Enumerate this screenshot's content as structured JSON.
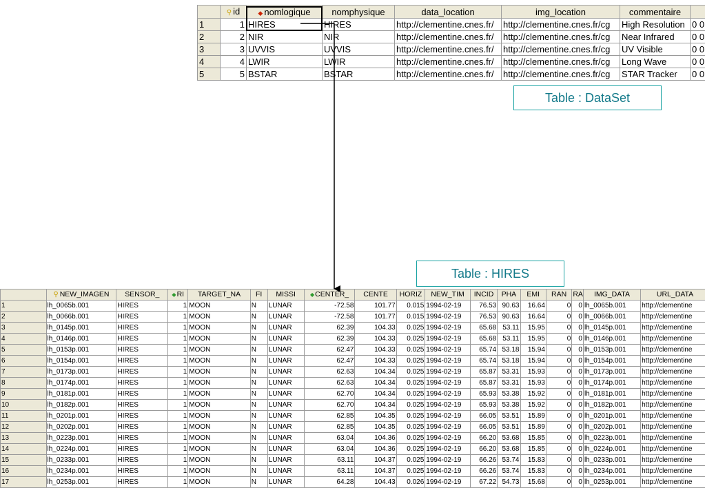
{
  "dataset_table": {
    "headers": [
      "id",
      "nomlogique",
      "nomphysique",
      "data_location",
      "img_location",
      "commentaire",
      ""
    ],
    "rows": [
      {
        "rownum": "1",
        "id": "1",
        "nomlogique": "HIRES",
        "nomphysique": "HIRES",
        "data_location": "http://clementine.cnes.fr/",
        "img_location": "http://clementine.cnes.fr/cg",
        "commentaire": "High Resolution",
        "extra": "0 0"
      },
      {
        "rownum": "2",
        "id": "2",
        "nomlogique": "NIR",
        "nomphysique": "NIR",
        "data_location": "http://clementine.cnes.fr/",
        "img_location": "http://clementine.cnes.fr/cg",
        "commentaire": "Near Infrared",
        "extra": "0 0"
      },
      {
        "rownum": "3",
        "id": "3",
        "nomlogique": "UVVIS",
        "nomphysique": "UVVIS",
        "data_location": "http://clementine.cnes.fr/",
        "img_location": "http://clementine.cnes.fr/cg",
        "commentaire": "UV Visible",
        "extra": "0 0"
      },
      {
        "rownum": "4",
        "id": "4",
        "nomlogique": "LWIR",
        "nomphysique": "LWIR",
        "data_location": "http://clementine.cnes.fr/",
        "img_location": "http://clementine.cnes.fr/cg",
        "commentaire": "Long Wave",
        "extra": "0 0"
      },
      {
        "rownum": "5",
        "id": "5",
        "nomlogique": "BSTAR",
        "nomphysique": "BSTAR",
        "data_location": "http://clementine.cnes.fr/",
        "img_location": "http://clementine.cnes.fr/cg",
        "commentaire": "STAR Tracker",
        "extra": "0 0"
      }
    ]
  },
  "callouts": {
    "dataset": "Table : DataSet",
    "hires": "Table : HIRES"
  },
  "hires_table": {
    "headers": [
      "NEW_IMAGEN",
      "SENSOR_",
      "RI",
      "TARGET_NA",
      "FI",
      "MISSI",
      "CENTER_",
      "CENTE",
      "HORIZ",
      "NEW_TIM",
      "INCID",
      "PHA",
      "EMI",
      "RAN",
      "RA",
      "IMG_DATA",
      "URL_DATA"
    ],
    "rows": [
      {
        "rownum": "1",
        "cells": [
          "lh_0065b.001",
          "HIRES",
          "1",
          "MOON",
          "N",
          "LUNAR",
          "-72.58",
          "101.77",
          "0.015",
          "1994-02-19",
          "76.53",
          "90.63",
          "16.64",
          "0",
          "0",
          "lh_0065b.001",
          "http://clementine"
        ]
      },
      {
        "rownum": "2",
        "cells": [
          "lh_0066b.001",
          "HIRES",
          "1",
          "MOON",
          "N",
          "LUNAR",
          "-72.58",
          "101.77",
          "0.015",
          "1994-02-19",
          "76.53",
          "90.63",
          "16.64",
          "0",
          "0",
          "lh_0066b.001",
          "http://clementine"
        ]
      },
      {
        "rownum": "3",
        "cells": [
          "lh_0145p.001",
          "HIRES",
          "1",
          "MOON",
          "N",
          "LUNAR",
          "62.39",
          "104.33",
          "0.025",
          "1994-02-19",
          "65.68",
          "53.11",
          "15.95",
          "0",
          "0",
          "lh_0145p.001",
          "http://clementine"
        ]
      },
      {
        "rownum": "4",
        "cells": [
          "lh_0146p.001",
          "HIRES",
          "1",
          "MOON",
          "N",
          "LUNAR",
          "62.39",
          "104.33",
          "0.025",
          "1994-02-19",
          "65.68",
          "53.11",
          "15.95",
          "0",
          "0",
          "lh_0146p.001",
          "http://clementine"
        ]
      },
      {
        "rownum": "5",
        "cells": [
          "lh_0153p.001",
          "HIRES",
          "1",
          "MOON",
          "N",
          "LUNAR",
          "62.47",
          "104.33",
          "0.025",
          "1994-02-19",
          "65.74",
          "53.18",
          "15.94",
          "0",
          "0",
          "lh_0153p.001",
          "http://clementine"
        ]
      },
      {
        "rownum": "6",
        "cells": [
          "lh_0154p.001",
          "HIRES",
          "1",
          "MOON",
          "N",
          "LUNAR",
          "62.47",
          "104.33",
          "0.025",
          "1994-02-19",
          "65.74",
          "53.18",
          "15.94",
          "0",
          "0",
          "lh_0154p.001",
          "http://clementine"
        ]
      },
      {
        "rownum": "7",
        "cells": [
          "lh_0173p.001",
          "HIRES",
          "1",
          "MOON",
          "N",
          "LUNAR",
          "62.63",
          "104.34",
          "0.025",
          "1994-02-19",
          "65.87",
          "53.31",
          "15.93",
          "0",
          "0",
          "lh_0173p.001",
          "http://clementine"
        ]
      },
      {
        "rownum": "8",
        "cells": [
          "lh_0174p.001",
          "HIRES",
          "1",
          "MOON",
          "N",
          "LUNAR",
          "62.63",
          "104.34",
          "0.025",
          "1994-02-19",
          "65.87",
          "53.31",
          "15.93",
          "0",
          "0",
          "lh_0174p.001",
          "http://clementine"
        ]
      },
      {
        "rownum": "9",
        "cells": [
          "lh_0181p.001",
          "HIRES",
          "1",
          "MOON",
          "N",
          "LUNAR",
          "62.70",
          "104.34",
          "0.025",
          "1994-02-19",
          "65.93",
          "53.38",
          "15.92",
          "0",
          "0",
          "lh_0181p.001",
          "http://clementine"
        ]
      },
      {
        "rownum": "10",
        "cells": [
          "lh_0182p.001",
          "HIRES",
          "1",
          "MOON",
          "N",
          "LUNAR",
          "62.70",
          "104.34",
          "0.025",
          "1994-02-19",
          "65.93",
          "53.38",
          "15.92",
          "0",
          "0",
          "lh_0182p.001",
          "http://clementine"
        ]
      },
      {
        "rownum": "11",
        "cells": [
          "lh_0201p.001",
          "HIRES",
          "1",
          "MOON",
          "N",
          "LUNAR",
          "62.85",
          "104.35",
          "0.025",
          "1994-02-19",
          "66.05",
          "53.51",
          "15.89",
          "0",
          "0",
          "lh_0201p.001",
          "http://clementine"
        ]
      },
      {
        "rownum": "12",
        "cells": [
          "lh_0202p.001",
          "HIRES",
          "1",
          "MOON",
          "N",
          "LUNAR",
          "62.85",
          "104.35",
          "0.025",
          "1994-02-19",
          "66.05",
          "53.51",
          "15.89",
          "0",
          "0",
          "lh_0202p.001",
          "http://clementine"
        ]
      },
      {
        "rownum": "13",
        "cells": [
          "lh_0223p.001",
          "HIRES",
          "1",
          "MOON",
          "N",
          "LUNAR",
          "63.04",
          "104.36",
          "0.025",
          "1994-02-19",
          "66.20",
          "53.68",
          "15.85",
          "0",
          "0",
          "lh_0223p.001",
          "http://clementine"
        ]
      },
      {
        "rownum": "14",
        "cells": [
          "lh_0224p.001",
          "HIRES",
          "1",
          "MOON",
          "N",
          "LUNAR",
          "63.04",
          "104.36",
          "0.025",
          "1994-02-19",
          "66.20",
          "53.68",
          "15.85",
          "0",
          "0",
          "lh_0224p.001",
          "http://clementine"
        ]
      },
      {
        "rownum": "15",
        "cells": [
          "lh_0233p.001",
          "HIRES",
          "1",
          "MOON",
          "N",
          "LUNAR",
          "63.11",
          "104.37",
          "0.025",
          "1994-02-19",
          "66.26",
          "53.74",
          "15.83",
          "0",
          "0",
          "lh_0233p.001",
          "http://clementine"
        ]
      },
      {
        "rownum": "16",
        "cells": [
          "lh_0234p.001",
          "HIRES",
          "1",
          "MOON",
          "N",
          "LUNAR",
          "63.11",
          "104.37",
          "0.025",
          "1994-02-19",
          "66.26",
          "53.74",
          "15.83",
          "0",
          "0",
          "lh_0234p.001",
          "http://clementine"
        ]
      },
      {
        "rownum": "17",
        "cells": [
          "lh_0253p.001",
          "HIRES",
          "1",
          "MOON",
          "N",
          "LUNAR",
          "64.28",
          "104.43",
          "0.026",
          "1994-02-19",
          "67.22",
          "54.73",
          "15.68",
          "0",
          "0",
          "lh_0253p.001",
          "http://clementine"
        ]
      }
    ]
  },
  "icons": {
    "primary_key": "key-icon",
    "foreign_key_red": "fk-diamond-red-icon",
    "foreign_key_green": "fk-diamond-green-icon"
  },
  "colors": {
    "callout_border": "#1aa3a3",
    "callout_text": "#137a8a",
    "header_bg": "#ece9d8",
    "grid_line": "#9a9a9a"
  }
}
